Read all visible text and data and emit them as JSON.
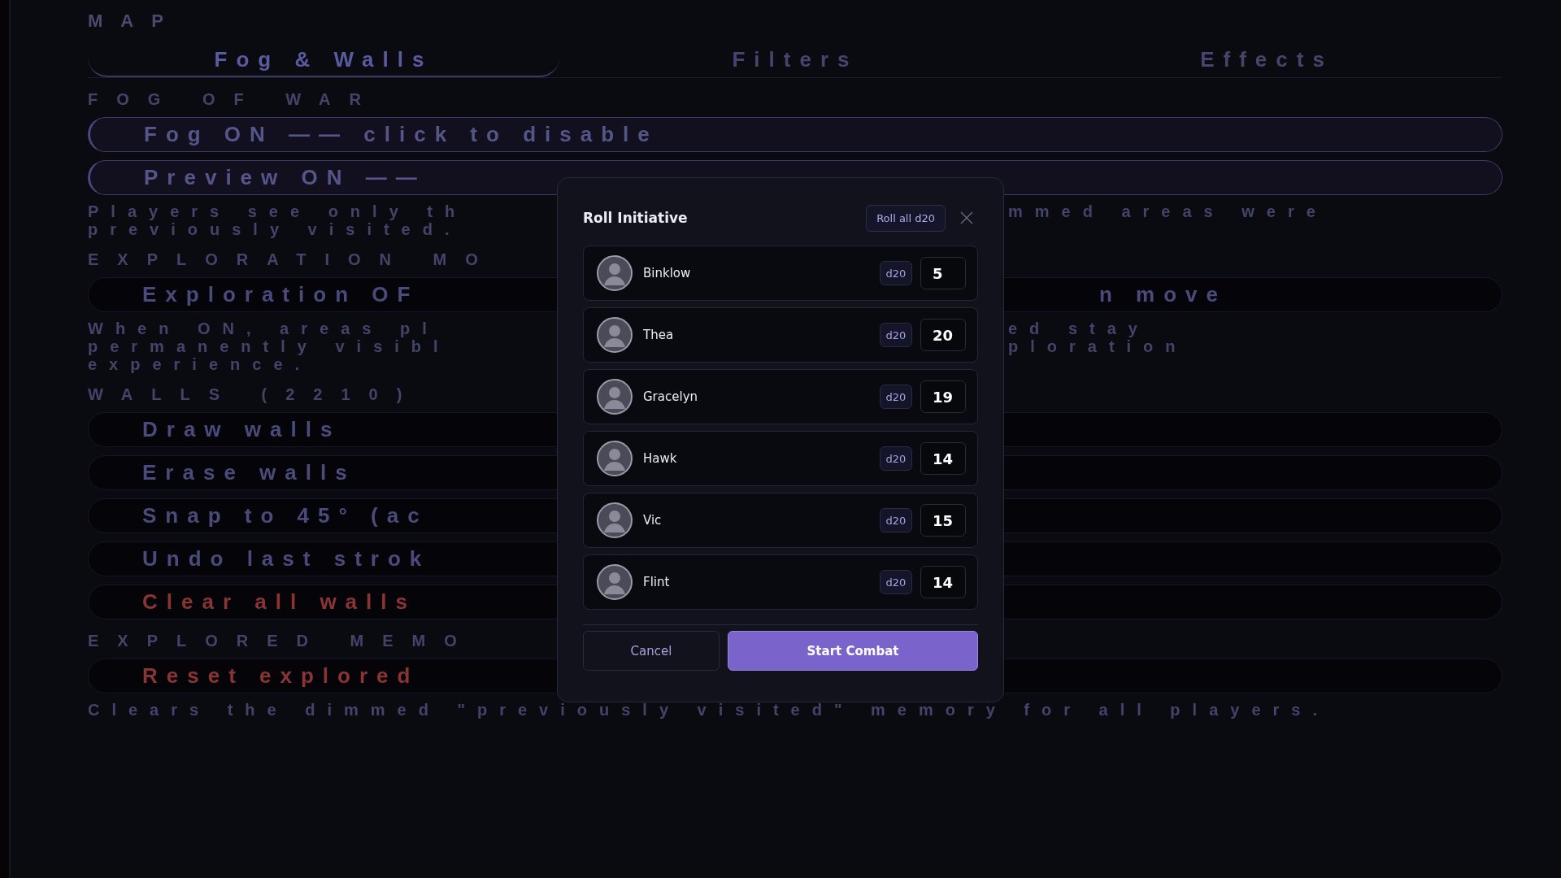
{
  "heading": "MAP",
  "tabs": [
    {
      "label": "Fog & Walls",
      "selected": true
    },
    {
      "label": "Filters",
      "selected": false
    },
    {
      "label": "Effects",
      "selected": false
    }
  ],
  "sections": [
    {
      "title": "FOG OF WAR",
      "items": [
        {
          "kind": "toggle",
          "on": true,
          "label": "Fog ON —— click to disable"
        },
        {
          "kind": "toggle",
          "on": true,
          "label": "Preview ON ——"
        },
        {
          "kind": "note",
          "lines": [
            "Players see only th",
            "previously visited."
          ],
          "right_lines": [
            "mmed areas were"
          ]
        }
      ]
    },
    {
      "title": "EXPLORATION MO",
      "items": [
        {
          "kind": "toggle",
          "on": false,
          "label": "Exploration OF",
          "label_right": "n move"
        },
        {
          "kind": "note",
          "lines": [
            "When ON, areas pl",
            "permanently visibl",
            "experience."
          ],
          "right_lines": [
            "ed stay",
            "ploration"
          ]
        }
      ]
    },
    {
      "title": "WALLS (2210)",
      "items": [
        {
          "kind": "action",
          "label": "Draw walls"
        },
        {
          "kind": "action",
          "label": "Erase walls"
        },
        {
          "kind": "action",
          "label": "Snap to 45° (ac"
        },
        {
          "kind": "action",
          "label": "Undo last strok"
        },
        {
          "kind": "danger",
          "label": "Clear all walls"
        }
      ]
    },
    {
      "title": "EXPLORED MEMO",
      "items": [
        {
          "kind": "danger",
          "label": "Reset explored"
        },
        {
          "kind": "wide_note",
          "text": "Clears the dimmed \"previously visited\" memory for all players."
        }
      ]
    }
  ],
  "dialog": {
    "title": "Roll Initiative",
    "roll_all": "Roll all d20",
    "combatants": [
      {
        "name": "Binklow",
        "die": "d20",
        "value": "5"
      },
      {
        "name": "Thea",
        "die": "d20",
        "value": "20"
      },
      {
        "name": "Gracelyn",
        "die": "d20",
        "value": "19"
      },
      {
        "name": "Hawk",
        "die": "d20",
        "value": "14"
      },
      {
        "name": "Vic",
        "die": "d20",
        "value": "15"
      },
      {
        "name": "Flint",
        "die": "d20",
        "value": "14"
      }
    ],
    "cancel": "Cancel",
    "confirm": "Start Combat"
  }
}
